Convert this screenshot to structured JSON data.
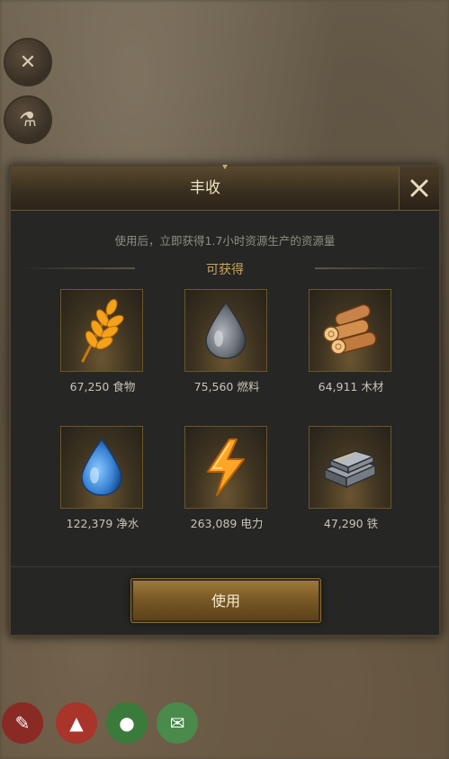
{
  "dialog": {
    "title": "丰收",
    "description": "使用后，立即获得1.7小时资源生产的资源量",
    "section_title": "可获得",
    "use_button": "使用"
  },
  "resources": [
    {
      "icon": "wheat-icon",
      "label": "67,250 食物"
    },
    {
      "icon": "oil-drop-icon",
      "label": "75,560 燃料"
    },
    {
      "icon": "wood-logs-icon",
      "label": "64,911 木材"
    },
    {
      "icon": "water-drop-icon",
      "label": "122,379 净水"
    },
    {
      "icon": "lightning-icon",
      "label": "263,089 电力"
    },
    {
      "icon": "iron-ingot-icon",
      "label": "47,290 铁"
    }
  ],
  "colors": {
    "accent_gold": "#c9a465",
    "title_text": "#efe2c4",
    "panel_bg": "#262624"
  }
}
